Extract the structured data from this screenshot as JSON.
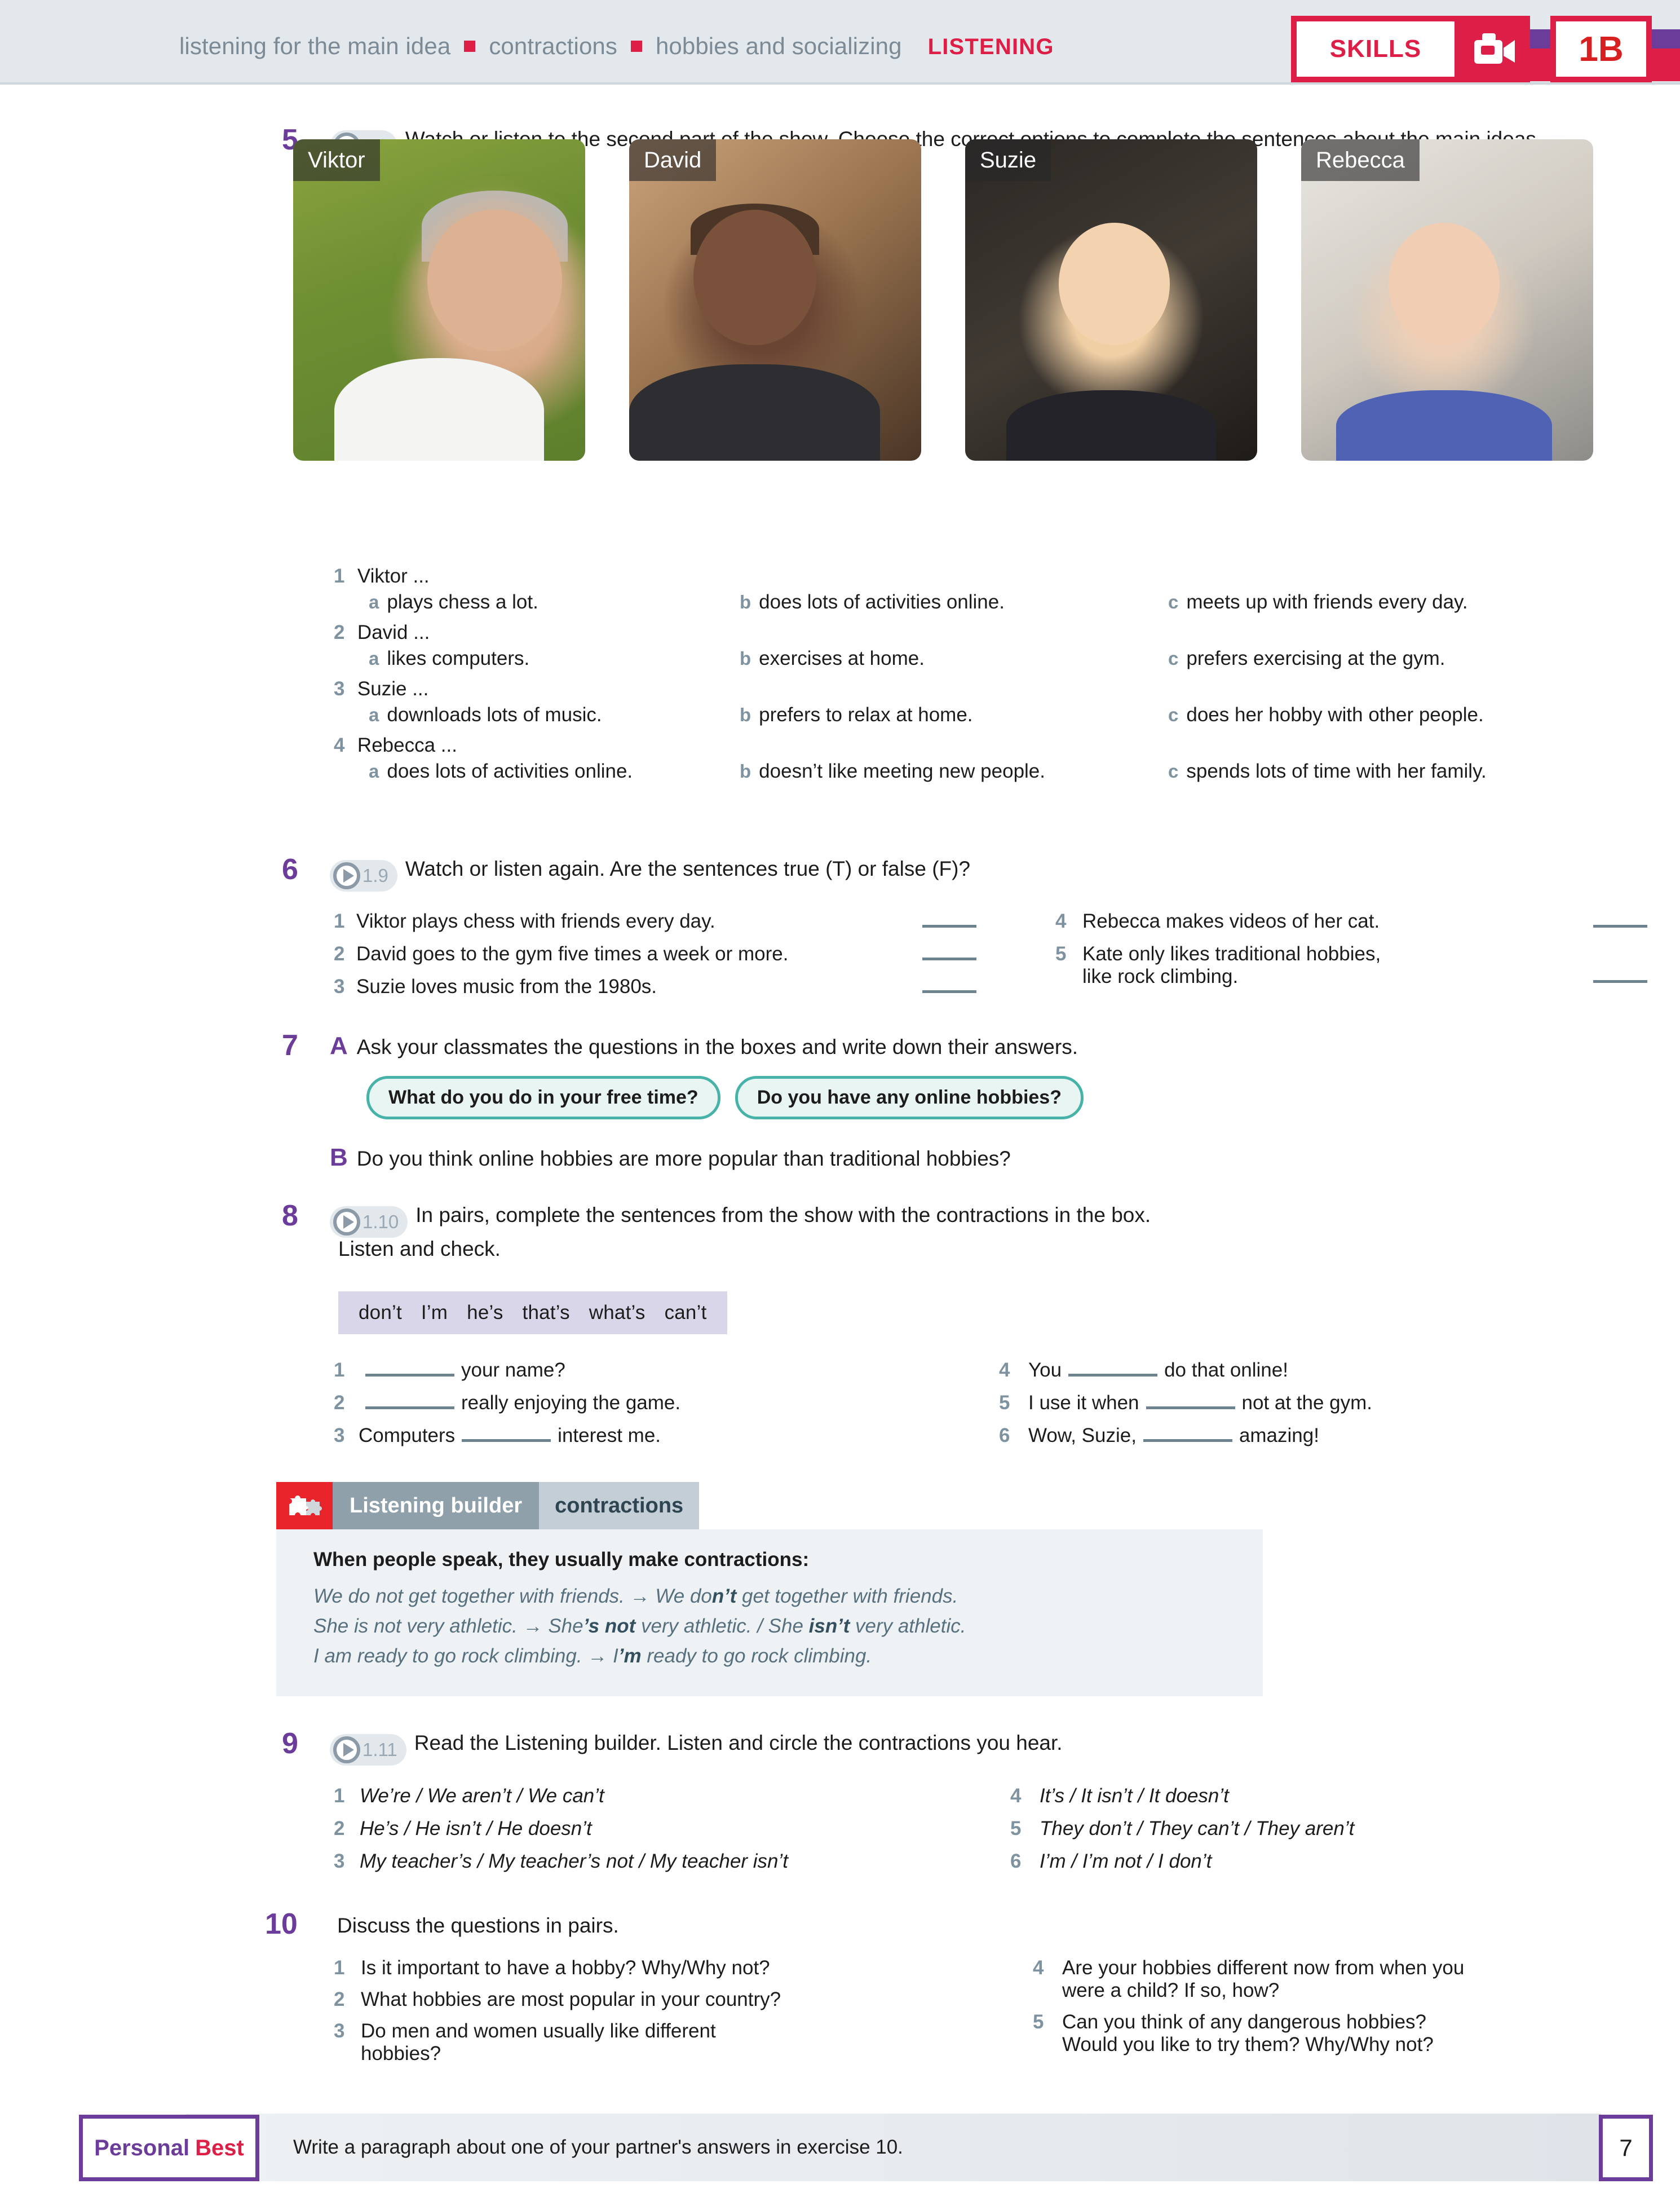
{
  "header": {
    "topics": [
      "listening for the main idea",
      "contractions",
      "hobbies and socializing"
    ],
    "skill_label": "LISTENING",
    "skills_badge": "SKILLS",
    "unit_badge": "1B",
    "video_icon": "video-camera-icon",
    "colors": {
      "red": "#dd1f47",
      "purple": "#6b3c9a",
      "grey_bg": "#e3e8ec"
    }
  },
  "exercises": {
    "ex5": {
      "number": "5",
      "audio": "1.9",
      "instruction": "Watch or listen to the second part of the show. Choose the correct options to complete the sentences about the main ideas.",
      "photos": [
        {
          "name": "Viktor"
        },
        {
          "name": "David"
        },
        {
          "name": "Suzie"
        },
        {
          "name": "Rebecca"
        }
      ],
      "items": [
        {
          "num": "1",
          "stem": "Viktor ...",
          "options": [
            {
              "letter": "a",
              "text": "plays chess a lot."
            },
            {
              "letter": "b",
              "text": "does lots of activities online."
            },
            {
              "letter": "c",
              "text": "meets up with friends every day."
            }
          ]
        },
        {
          "num": "2",
          "stem": "David ...",
          "options": [
            {
              "letter": "a",
              "text": "likes computers."
            },
            {
              "letter": "b",
              "text": "exercises at home."
            },
            {
              "letter": "c",
              "text": "prefers exercising at the gym."
            }
          ]
        },
        {
          "num": "3",
          "stem": "Suzie ...",
          "options": [
            {
              "letter": "a",
              "text": "downloads lots of music."
            },
            {
              "letter": "b",
              "text": "prefers to relax at home."
            },
            {
              "letter": "c",
              "text": "does her hobby with other people."
            }
          ]
        },
        {
          "num": "4",
          "stem": "Rebecca ...",
          "options": [
            {
              "letter": "a",
              "text": "does lots of activities online."
            },
            {
              "letter": "b",
              "text": "doesn’t like meeting new people."
            },
            {
              "letter": "c",
              "text": "spends lots of time with her family."
            }
          ]
        }
      ]
    },
    "ex6": {
      "number": "6",
      "audio": "1.9",
      "instruction": "Watch or listen again. Are the sentences true (T) or false (F)?",
      "left": [
        {
          "num": "1",
          "text": "Viktor plays chess with friends every day."
        },
        {
          "num": "2",
          "text": "David goes to the gym five times a week or more."
        },
        {
          "num": "3",
          "text": "Suzie loves music from the 1980s."
        }
      ],
      "right": [
        {
          "num": "4",
          "text": "Rebecca makes videos of her cat.",
          "text2": ""
        },
        {
          "num": "5",
          "text": "Kate only likes traditional hobbies,",
          "text2": "like rock climbing."
        }
      ]
    },
    "ex7": {
      "number": "7",
      "part_a_letter": "A",
      "part_a_text": "Ask your classmates the questions in the boxes and write down their answers.",
      "boxes": [
        "What do you do in your free time?",
        "Do you have any online hobbies?"
      ],
      "part_b_letter": "B",
      "part_b_text": "Do you think online hobbies are more popular than traditional hobbies?"
    },
    "ex8": {
      "number": "8",
      "audio": "1.10",
      "instruction_line1": "In pairs, complete the sentences from the show with the contractions in the box.",
      "instruction_line2": "Listen and check.",
      "word_bank": [
        "don’t",
        "I’m",
        "he’s",
        "that’s",
        "what’s",
        "can’t"
      ],
      "left": [
        {
          "num": "1",
          "pre": "",
          "post": "your name?"
        },
        {
          "num": "2",
          "pre": "",
          "post": "really enjoying the game."
        },
        {
          "num": "3",
          "pre": "Computers",
          "post": "interest me."
        }
      ],
      "right": [
        {
          "num": "4",
          "pre": "You",
          "post": "do that online!"
        },
        {
          "num": "5",
          "pre": "I use it when",
          "post": "not at the gym."
        },
        {
          "num": "6",
          "pre": "Wow, Suzie,",
          "post": "amazing!"
        }
      ]
    },
    "listening_builder": {
      "icon": "puzzle-pieces-icon",
      "title": "Listening builder",
      "subtitle": "contractions",
      "lead": "When people speak, they usually make contractions:",
      "examples": [
        {
          "before": "We do not get together with friends.",
          "arrow": "→",
          "after_pre": "We do",
          "after_bold": "n’t",
          "after_post": " get together with friends."
        },
        {
          "before": "She is not very athletic.",
          "arrow": "→",
          "after_pre": "She",
          "after_bold": "’s not",
          "after_post": " very athletic. / She ",
          "after_bold2": "isn’t",
          "after_post2": " very athletic."
        },
        {
          "before": "I am ready to go rock climbing.",
          "arrow": "→",
          "after_pre": "I",
          "after_bold": "’m",
          "after_post": " ready to go rock climbing."
        }
      ]
    },
    "ex9": {
      "number": "9",
      "audio": "1.11",
      "instruction": "Read the Listening builder. Listen and circle the contractions you hear.",
      "left": [
        {
          "num": "1",
          "text": "We’re / We aren’t / We can’t"
        },
        {
          "num": "2",
          "text": "He’s / He isn’t / He doesn’t"
        },
        {
          "num": "3",
          "text": "My teacher’s / My teacher’s not / My teacher isn’t"
        }
      ],
      "right": [
        {
          "num": "4",
          "text": "It’s / It isn’t / It doesn’t"
        },
        {
          "num": "5",
          "text": "They don’t / They can’t / They aren’t"
        },
        {
          "num": "6",
          "text": "I’m / I’m not / I don’t"
        }
      ]
    },
    "ex10": {
      "number": "10",
      "instruction": "Discuss the questions in pairs.",
      "left": [
        {
          "num": "1",
          "line1": "Is it important to have a hobby? Why/Why not?",
          "line2": ""
        },
        {
          "num": "2",
          "line1": "What hobbies are most popular in your country?",
          "line2": ""
        },
        {
          "num": "3",
          "line1": "Do men and women usually like different",
          "line2": "hobbies?"
        }
      ],
      "right": [
        {
          "num": "4",
          "line1": "Are your hobbies different now from when you",
          "line2": "were a child? If so, how?"
        },
        {
          "num": "5",
          "line1": "Can you think of any dangerous hobbies?",
          "line2": "Would you like to try them? Why/Why not?"
        }
      ]
    }
  },
  "footer": {
    "badge_word1": "Personal",
    "badge_word2": "Best",
    "text": "Write a paragraph about one of your partner's answers in exercise 10.",
    "page_number": "7"
  }
}
